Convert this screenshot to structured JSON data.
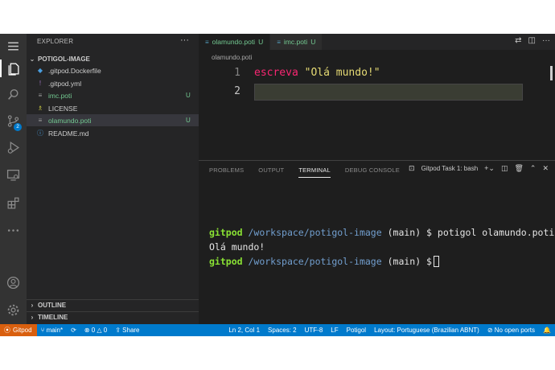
{
  "explorer": {
    "title": "EXPLORER",
    "more": "···",
    "project": "POTIGOL-IMAGE",
    "files": [
      {
        "name": ".gitpod.Dockerfile",
        "icon": "docker",
        "status": ""
      },
      {
        "name": ".gitpod.yml",
        "icon": "!",
        "status": ""
      },
      {
        "name": "imc.poti",
        "icon": "≡",
        "status": "U"
      },
      {
        "name": "LICENSE",
        "icon": "license",
        "status": ""
      },
      {
        "name": "olamundo.poti",
        "icon": "≡",
        "status": "U"
      },
      {
        "name": "README.md",
        "icon": "ⓘ",
        "status": ""
      }
    ],
    "outline": "OUTLINE",
    "timeline": "TIMELINE"
  },
  "activity": {
    "scm_badge": "2"
  },
  "tabs": [
    {
      "name": "olamundo.poti",
      "status": "U"
    },
    {
      "name": "imc.poti",
      "status": "U"
    }
  ],
  "breadcrumb": "olamundo.poti",
  "editor": {
    "line_numbers": [
      "1",
      "2"
    ],
    "keyword": "escreva",
    "string": "\"Olá mundo!\""
  },
  "panel": {
    "tabs": [
      "PROBLEMS",
      "OUTPUT",
      "TERMINAL",
      "DEBUG CONSOLE"
    ],
    "active_tab": "TERMINAL",
    "task": "Gitpod Task 1: bash",
    "terminal": {
      "user": "gitpod",
      "path": "/workspace/potigol-image",
      "branch": "(main) $",
      "command": "potigol olamundo.poti",
      "output": "Olá mundo!"
    }
  },
  "status": {
    "remote": "Gitpod",
    "branch": "main*",
    "errors": "0",
    "warnings": "0",
    "share": "Share",
    "position": "Ln 2, Col 1",
    "spaces": "Spaces: 2",
    "encoding": "UTF-8",
    "eol": "LF",
    "language": "Potigol",
    "layout": "Layout: Portuguese (Brazilian ABNT)",
    "ports": "No open ports"
  }
}
